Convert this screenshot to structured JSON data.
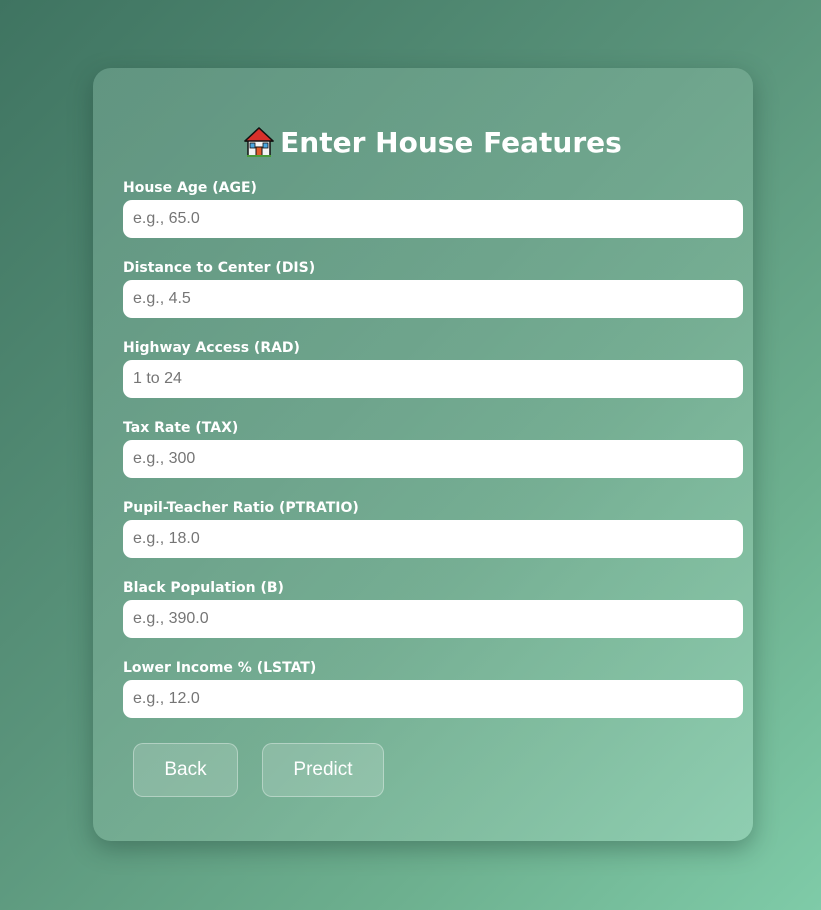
{
  "form": {
    "title": "Enter House Features",
    "title_icon": "house-emoji",
    "fields": [
      {
        "label": "House Age (AGE)",
        "placeholder": "e.g., 65.0"
      },
      {
        "label": "Distance to Center (DIS)",
        "placeholder": "e.g., 4.5"
      },
      {
        "label": "Highway Access (RAD)",
        "placeholder": "1 to 24"
      },
      {
        "label": "Tax Rate (TAX)",
        "placeholder": "e.g., 300"
      },
      {
        "label": "Pupil-Teacher Ratio (PTRATIO)",
        "placeholder": "e.g., 18.0"
      },
      {
        "label": "Black Population (B)",
        "placeholder": "e.g., 390.0"
      },
      {
        "label": "Lower Income % (LSTAT)",
        "placeholder": "e.g., 12.0"
      }
    ],
    "back_label": "Back",
    "predict_label": "Predict"
  },
  "colors": {
    "background_start": "#3f7461",
    "background_end": "#7fcba8",
    "text": "#ffffff"
  }
}
